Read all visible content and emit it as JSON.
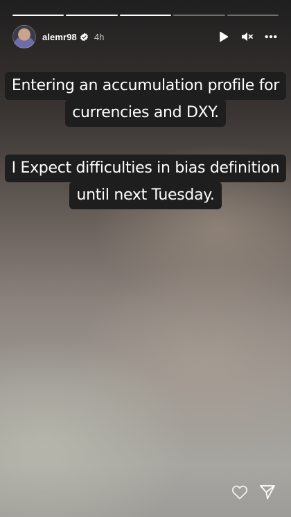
{
  "story": {
    "progress_segments": 5,
    "completed_segments": 3,
    "username": "alemr98",
    "time_ago": "4h",
    "paragraphs": [
      [
        "Entering an accumulation profile for",
        "currencies and DXY."
      ],
      [
        "I Expect difficulties in bias definition",
        "until next Tuesday."
      ]
    ]
  },
  "icons": {
    "play": "play-icon",
    "mute": "mute-icon",
    "more": "more-icon",
    "verified": "verified-badge-icon",
    "like": "heart-icon",
    "share": "send-icon"
  },
  "colors": {
    "text_bg": "#1e1e1e",
    "text": "#ffffff"
  }
}
